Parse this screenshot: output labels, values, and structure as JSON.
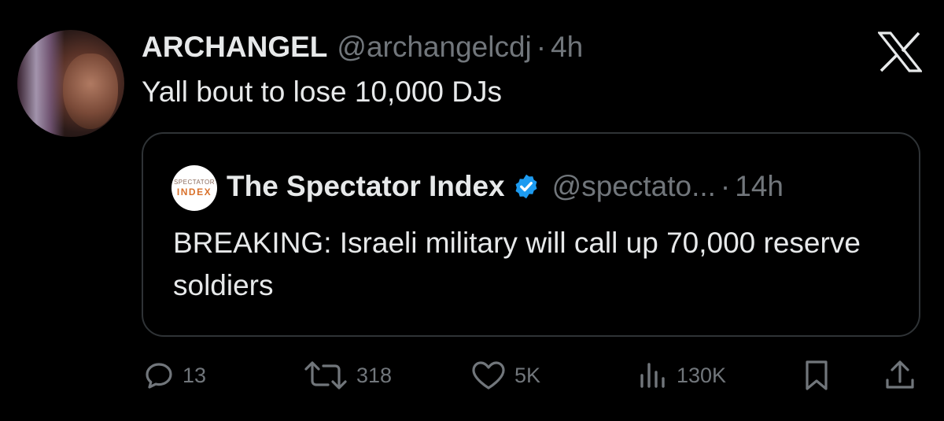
{
  "tweet": {
    "author_name": "ARCHANGEL",
    "author_handle": "@archangelcdj",
    "separator": "·",
    "time": "4h",
    "text": "Yall bout to lose 10,000 DJs"
  },
  "quoted_tweet": {
    "avatar_top_text": "SPECTATOR",
    "avatar_bottom_text": "INDEX",
    "author_name": "The Spectator Index",
    "verified": true,
    "author_handle": "@spectato...",
    "separator": "·",
    "time": "14h",
    "text": "BREAKING: Israeli military will call up 70,000 reserve soldiers"
  },
  "actions": {
    "replies": "13",
    "reposts": "318",
    "likes": "5K",
    "views": "130K"
  },
  "icons": {
    "reply": "speech-bubble-icon",
    "repost": "repost-arrows-icon",
    "like": "heart-icon",
    "views": "bar-chart-icon",
    "bookmark": "bookmark-icon",
    "share": "share-upload-icon",
    "brand": "x-logo-icon",
    "verified": "verified-badge-icon"
  },
  "colors": {
    "background": "#000000",
    "primary_text": "#e7e9ea",
    "secondary_text": "#71767b",
    "border": "#2f3336",
    "verified_blue": "#1d9bf0"
  }
}
